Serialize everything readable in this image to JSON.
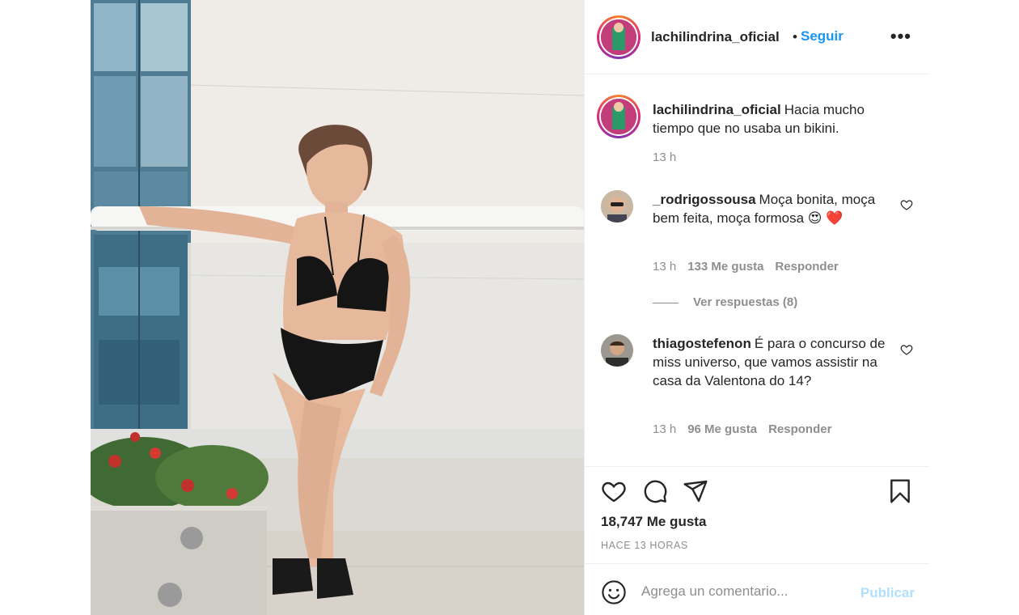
{
  "post": {
    "username": "lachilindrina_oficial",
    "separator": "•",
    "follow_label": "Seguir",
    "more_icon": "•••",
    "caption": {
      "username": "lachilindrina_oficial",
      "text": "Hacia mucho tiempo que no usaba un bikini.",
      "time": "13 h"
    },
    "comments": [
      {
        "username": "_rodrigossousa",
        "text": "Moça bonita, moça bem feita, moça formosa 😍 ❤️",
        "time": "13 h",
        "likes": "133 Me gusta",
        "reply": "Responder",
        "view_replies": "Ver respuestas (8)"
      },
      {
        "username": "thiagostefenon",
        "text": "É para o concurso de miss universo, que vamos assistir na casa da Valentona do 14?",
        "time": "13 h",
        "likes": "96 Me gusta",
        "reply": "Responder"
      }
    ],
    "likes_total": "18,747 Me gusta",
    "posted_ago": "HACE 13 HORAS",
    "comment_placeholder": "Agrega un comentario...",
    "publish_label": "Publicar",
    "icons": {
      "like": "heart-icon",
      "comment": "comment-icon",
      "share": "paper-plane-icon",
      "save": "bookmark-icon",
      "emoji": "emoji-icon"
    },
    "colors": {
      "link_blue": "#1a96f0",
      "publish_disabled": "#b2dffc",
      "muted": "#8e8e8e",
      "text": "#262626"
    }
  }
}
